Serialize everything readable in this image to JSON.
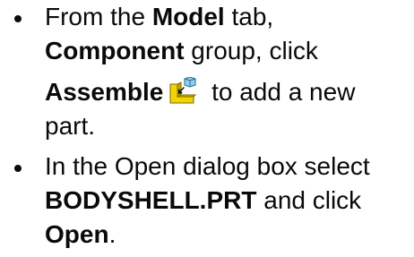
{
  "instructions": {
    "step1": {
      "t1": "From the ",
      "model_tab": "Model",
      "t2": " tab,",
      "component_group": "Component",
      "t3": " group, click",
      "assemble_button": "Assemble",
      "t4": " to add a new",
      "t5": "part."
    },
    "step2": {
      "t1": "In the Open dialog box select",
      "file_name": "BODYSHELL.PRT",
      "t2": " and click",
      "open_button": "Open",
      "t3": "."
    }
  },
  "icons": {
    "assemble": "assemble-icon"
  },
  "colors": {
    "text": "#0a0a0a",
    "icon_yellow": "#f2d400",
    "icon_blue": "#8fd0f0"
  }
}
